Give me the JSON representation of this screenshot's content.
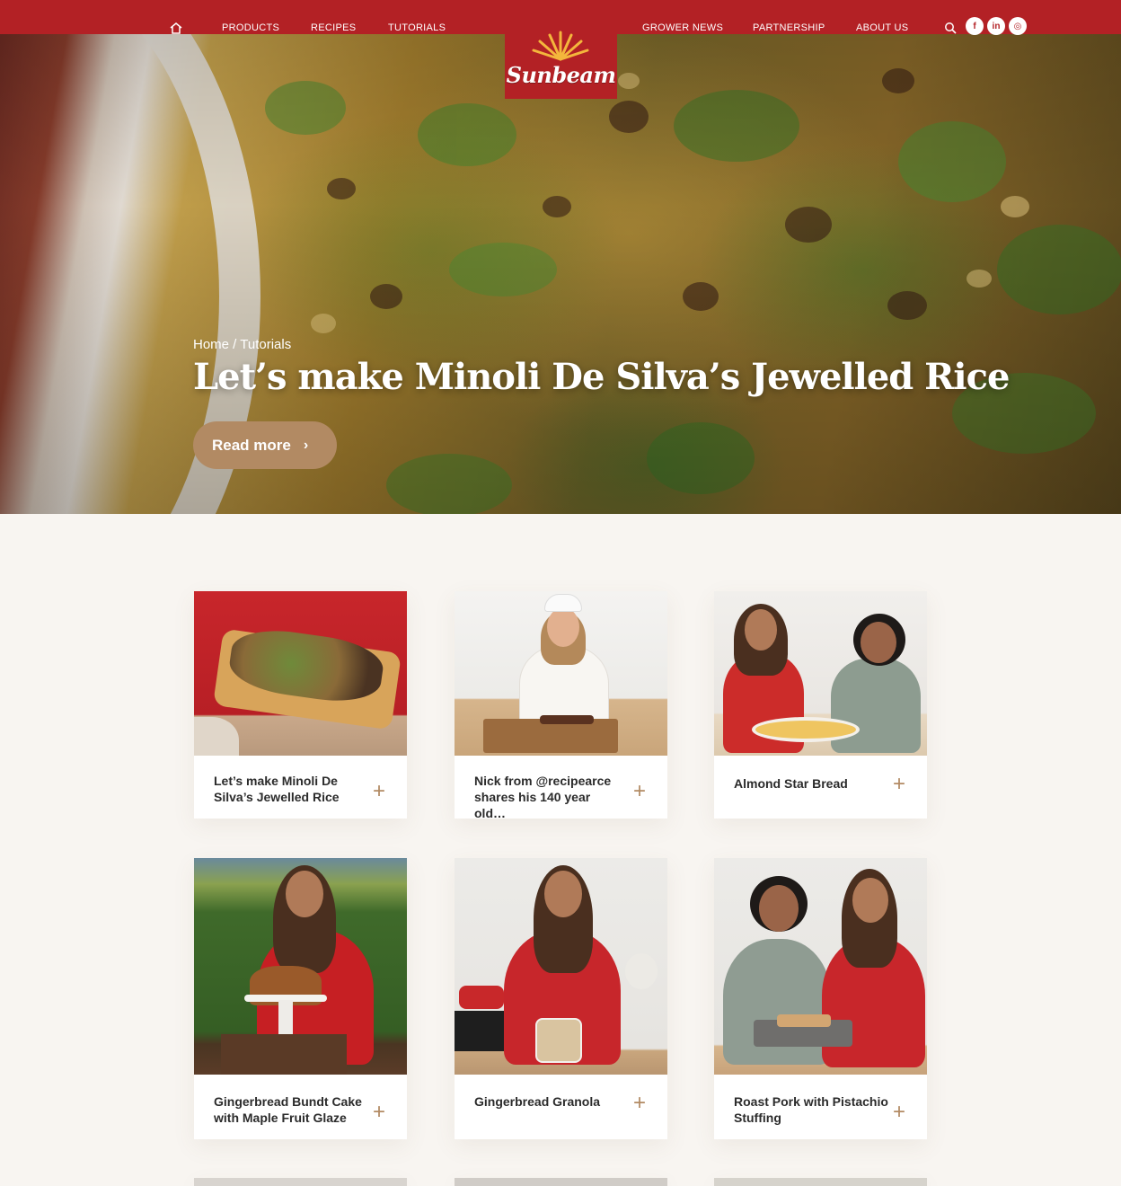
{
  "nav": {
    "left": [
      "PRODUCTS",
      "RECIPES",
      "TUTORIALS"
    ],
    "right": [
      "GROWER NEWS",
      "PARTNERSHIP",
      "ABOUT US"
    ],
    "brand": "Sunbeam",
    "social": [
      "f",
      "in",
      "◎"
    ]
  },
  "hero": {
    "breadcrumb_home": "Home",
    "breadcrumb_sep": " / ",
    "breadcrumb_current": "Tutorials",
    "title": "Let’s make Minoli De Silva’s Jewelled Rice",
    "cta": "Read more"
  },
  "cards": [
    {
      "title": "Let’s make Minoli De Silva’s Jewelled Rice"
    },
    {
      "title": "Nick from @recipearce shares his 140 year old…"
    },
    {
      "title": "Almond Star Bread"
    },
    {
      "title": "Gingerbread Bundt Cake with Maple Fruit Glaze"
    },
    {
      "title": "Gingerbread Granola"
    },
    {
      "title": "Roast Pork with Pistachio Stuffing"
    }
  ],
  "colors": {
    "brand_red": "#b32125",
    "accent_tan": "#b28a63",
    "page_bg": "#f8f5f1"
  }
}
